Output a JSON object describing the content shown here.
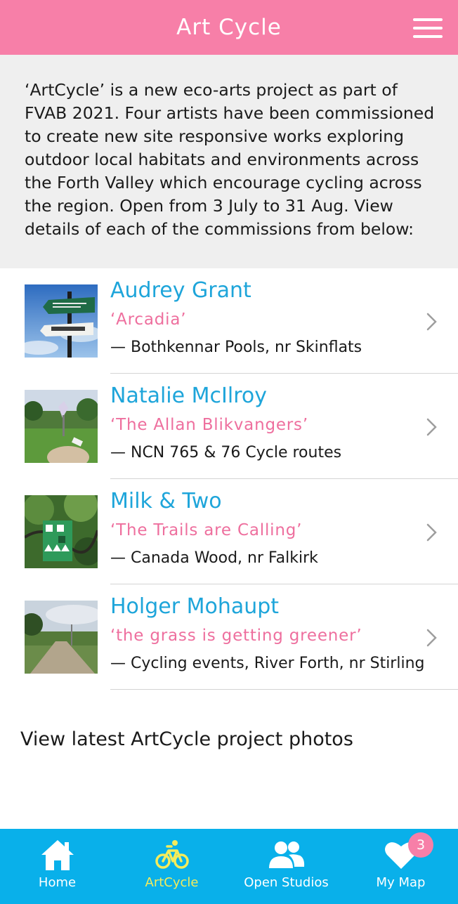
{
  "header": {
    "title": "Art Cycle",
    "menu_icon": "hamburger-menu-icon"
  },
  "intro": {
    "text": "‘ArtCycle’ is a new eco-arts project as part of FVAB 2021. Four artists have been commissioned to create new site responsive works exploring outdoor local habitats and environments across the Forth Valley which encourage cycling across the region. Open from 3 July to 31 Aug. View details of each of the commissions from below:"
  },
  "commissions": [
    {
      "artist": "Audrey Grant",
      "work": "‘Arcadia’",
      "location": "— Bothkennar Pools, nr Skinflats"
    },
    {
      "artist": "Natalie McIlroy",
      "work": "‘The Allan Blikvangers’",
      "location": "— NCN 765 & 76 Cycle routes"
    },
    {
      "artist": "Milk & Two",
      "work": "‘The Trails are Calling’",
      "location": "— Canada Wood, nr Falkirk"
    },
    {
      "artist": "Holger Mohaupt",
      "work": "‘the grass is getting greener’",
      "location": "— Cycling events, River Forth, nr Stirling"
    }
  ],
  "photos_link": "View latest ArtCycle project photos",
  "tabs": [
    {
      "label": "Home",
      "icon": "house-icon"
    },
    {
      "label": "ArtCycle",
      "icon": "bicycle-icon"
    },
    {
      "label": "Open Studios",
      "icon": "people-icon"
    },
    {
      "label": "My Map",
      "icon": "heart-icon",
      "badge": "3"
    }
  ],
  "colors": {
    "header_pink": "#f77fa8",
    "artist_blue": "#1ea5da",
    "work_pink": "#ee6f9e",
    "tabbar_blue": "#09b0ea",
    "active_yellow": "#f4ec5b"
  }
}
